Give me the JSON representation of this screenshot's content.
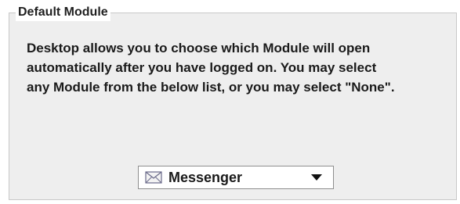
{
  "panel": {
    "title": "Default Module",
    "description": "Desktop allows you to choose which Module will open\nautomatically after you have logged on.  You may select\nany Module from the below list, or you may select \"None\"."
  },
  "module_select": {
    "selected_value": "Messenger",
    "selected_icon": "envelope-icon"
  },
  "colors": {
    "panel_background": "#eeeeee",
    "panel_border": "#c9c9c9",
    "text": "#1a1a1a"
  }
}
